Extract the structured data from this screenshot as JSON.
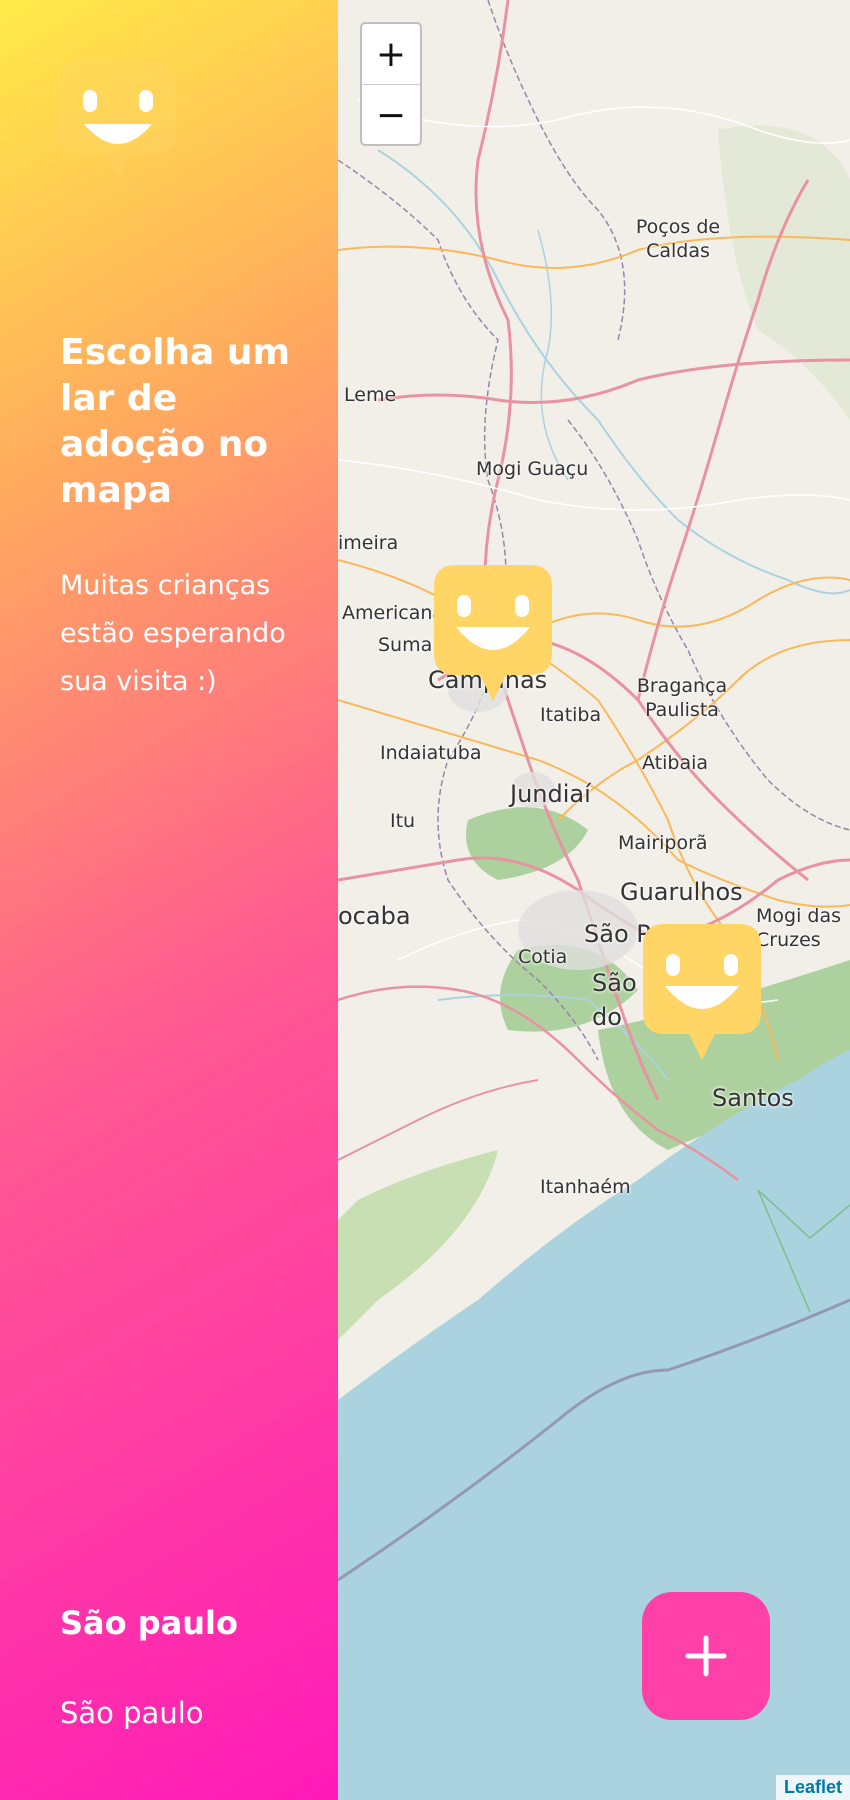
{
  "sidebar": {
    "logo_icon": "smile-face-icon",
    "title": "Escolha um lar de adoção no mapa",
    "description": "Muitas crianças estão esperando sua visita :)",
    "city": "São paulo",
    "state": "São paulo"
  },
  "map": {
    "zoom_in_label": "+",
    "zoom_out_label": "−",
    "attribution": "Leaflet",
    "marker_icon": "smile-marker-icon",
    "add_button_icon": "plus-icon",
    "labels": {
      "pocos": "Poços de Caldas",
      "leme": "Leme",
      "mogi_guacu": "Mogi Guaçu",
      "limeira": "imeira",
      "americana": "Americana",
      "sumare": "Sumar",
      "campinas": "Campinas",
      "braganca": "Bragança Paulista",
      "itatiba": "Itatiba",
      "indaiatuba": "Indaiatuba",
      "atibaia": "Atibaia",
      "jundiai": "Jundiaí",
      "itu": "Itu",
      "mairipora": "Mairiporã",
      "guarulhos": "Guarulhos",
      "sorocaba": "ocaba",
      "sao_paulo": "São P",
      "mogi_cruzes": "Mogi das Cruzes",
      "cotia": "Cotia",
      "sao_bernardo": "São do",
      "santos": "Santos",
      "itanhaem": "Itanhaém"
    }
  },
  "colors": {
    "gradient_top": "#FFEB48",
    "gradient_bottom": "#FF1AB8",
    "marker": "#FFD666",
    "add_button": "#FF40A8",
    "ocean": "#AAD3DF"
  }
}
